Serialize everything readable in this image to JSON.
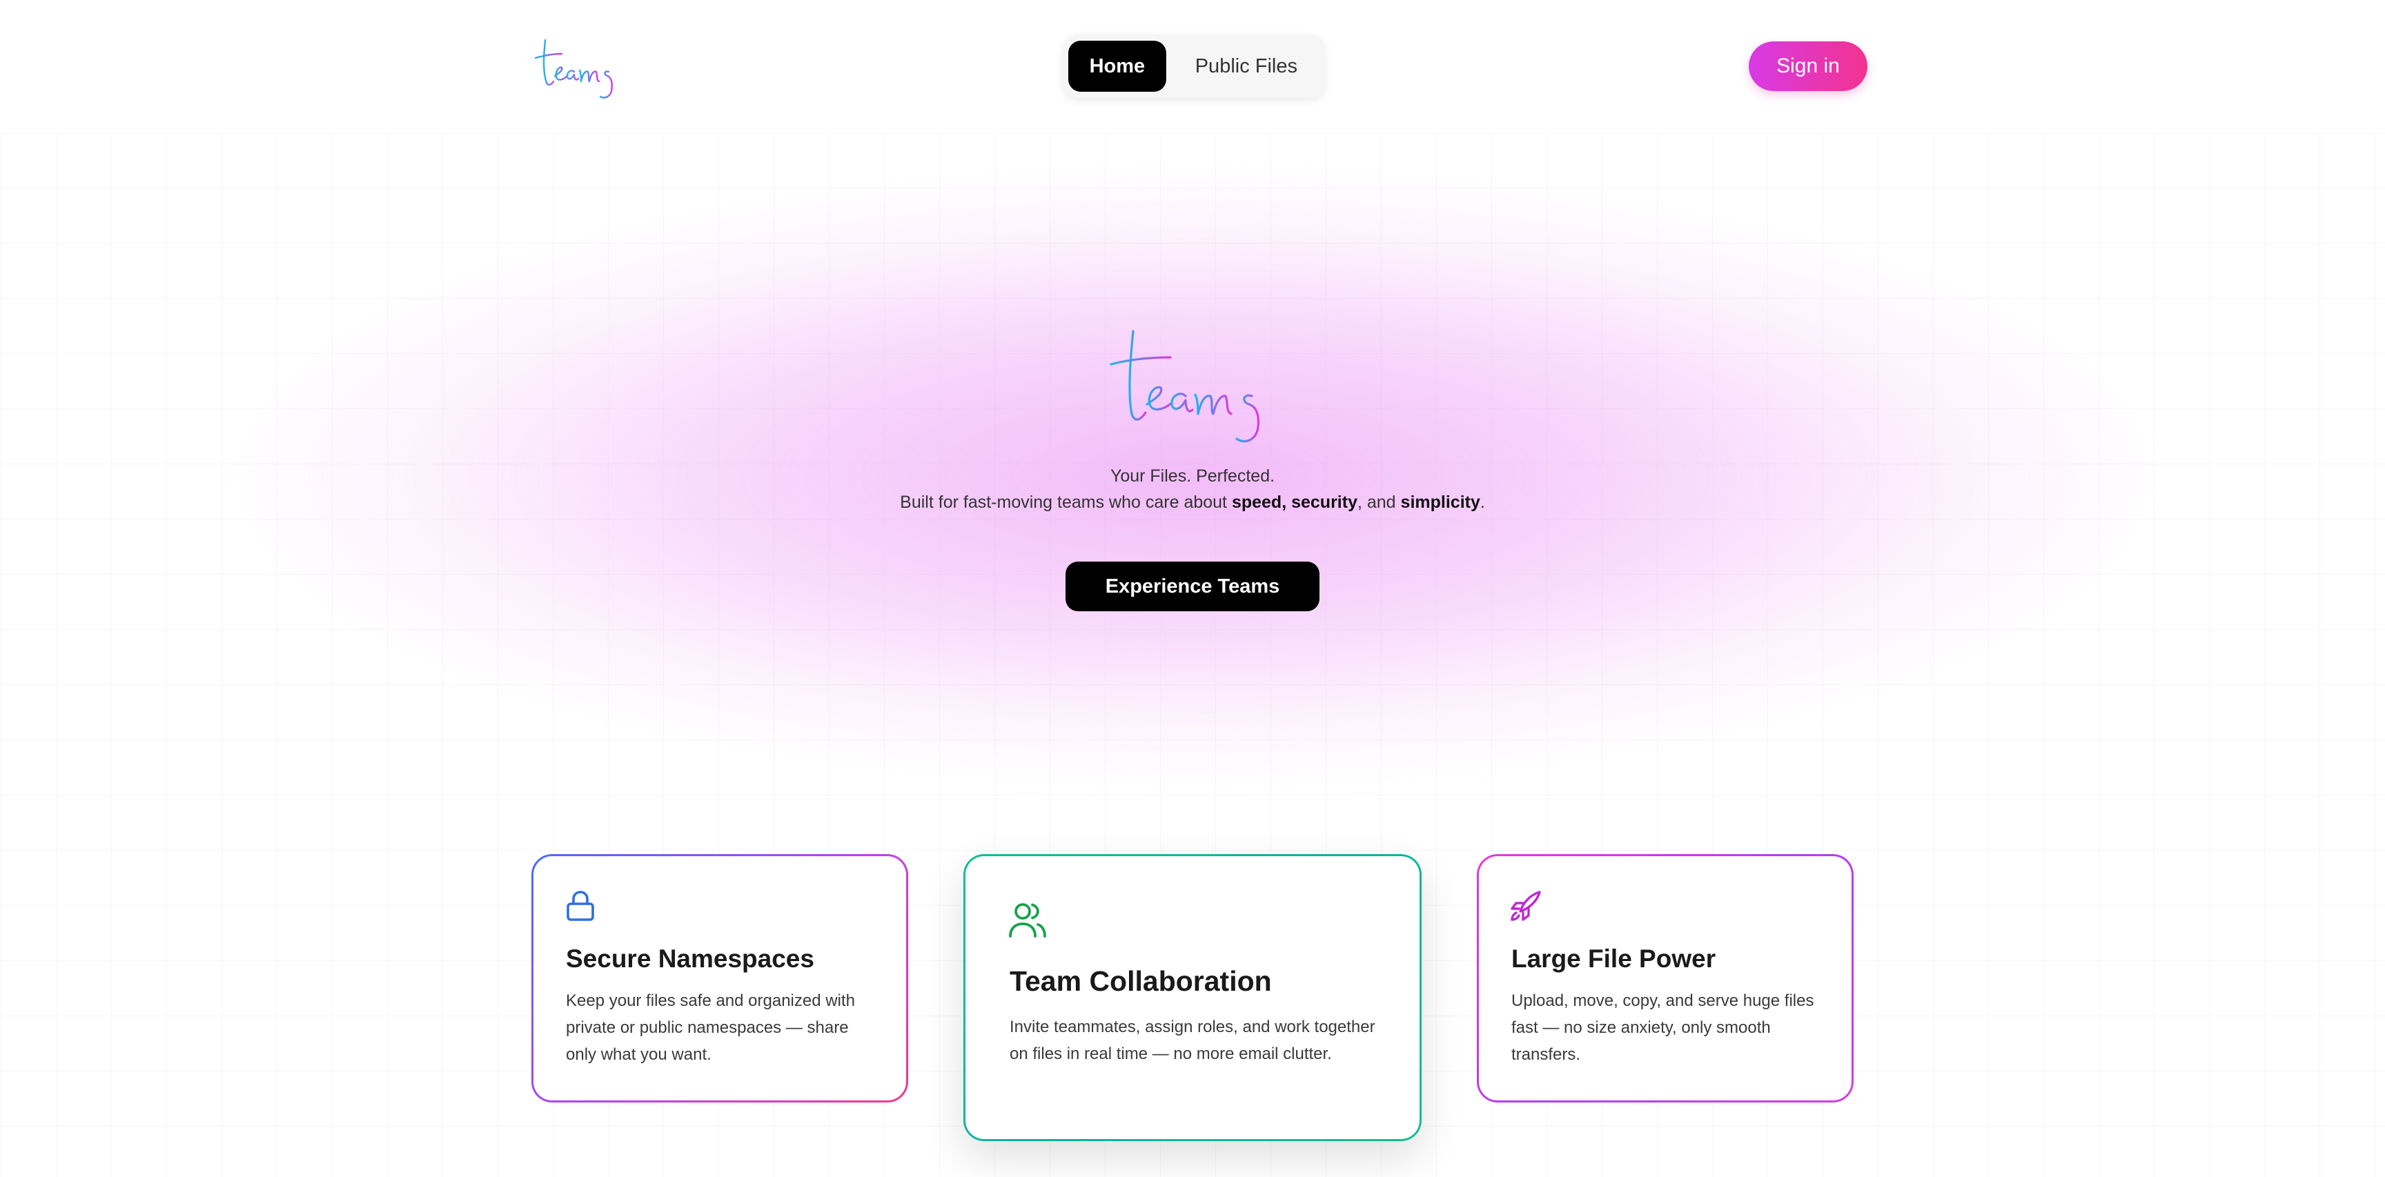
{
  "header": {
    "logo_text": "teams",
    "nav": [
      {
        "label": "Home",
        "active": true
      },
      {
        "label": "Public Files",
        "active": false
      }
    ],
    "signin_label": "Sign in"
  },
  "hero": {
    "logo_text": "teams",
    "tagline": "Your Files. Perfected.",
    "subline_prefix": "Built for fast-moving teams who care about ",
    "subline_bold1": "speed, security",
    "subline_middle": ", and ",
    "subline_bold2": "simplicity",
    "subline_suffix": ".",
    "cta_label": "Experience Teams"
  },
  "features": [
    {
      "icon": "lock-icon",
      "title": "Secure Namespaces",
      "description": "Keep your files safe and organized with private or public namespaces — share only what you want.",
      "icon_color": "#2f6fe0"
    },
    {
      "icon": "users-icon",
      "title": "Team Collaboration",
      "description": "Invite teammates, assign roles, and work together on files in real time — no more email clutter.",
      "icon_color": "#16a34a"
    },
    {
      "icon": "rocket-icon",
      "title": "Large File Power",
      "description": "Upload, move, copy, and serve huge files fast — no size anxiety, only smooth transfers.",
      "icon_color": "#c026d3"
    }
  ],
  "colors": {
    "accent_pink": "#f2338f",
    "accent_purple": "#d83ae6",
    "logo_gradient_start": "#1fb6e8",
    "logo_gradient_end": "#d83ae6"
  }
}
